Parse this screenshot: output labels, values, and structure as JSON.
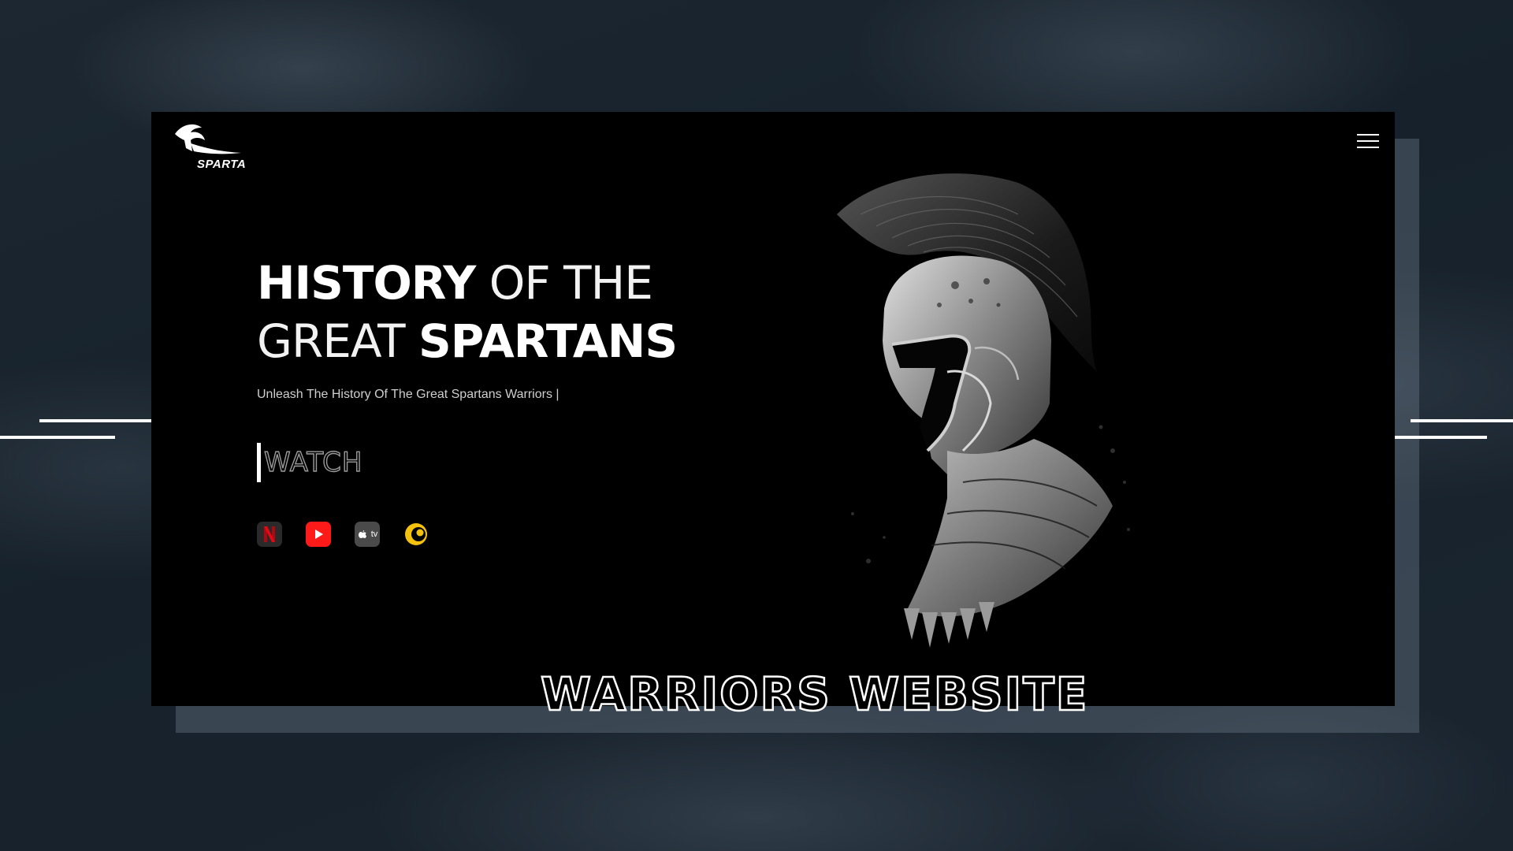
{
  "brand": {
    "logo_text": "SPARTA"
  },
  "hero": {
    "title_line1_bold": "HISTORY",
    "title_line1_thin": " OF THE",
    "title_line2_thin": "GREAT ",
    "title_line2_bold": "SPARTANS",
    "subtitle": "Unleash The History Of The Great Spartans Warriors |",
    "watch_label": "WATCH"
  },
  "platforms": [
    {
      "name": "Netflix",
      "icon": "netflix-icon",
      "color": "#e50914"
    },
    {
      "name": "YouTube",
      "icon": "youtube-icon",
      "color": "#ff1a1a"
    },
    {
      "name": "Apple TV",
      "icon": "appletv-icon",
      "color": "#4a4a4a"
    },
    {
      "name": "Crunchyroll",
      "icon": "crunchyroll-icon",
      "color": "#f4c20d"
    }
  ],
  "platform_labels": {
    "appletv": "tv"
  },
  "footer": {
    "title": "WARRIORS WEBSITE"
  },
  "colors": {
    "background": "#1b2631",
    "frame": "#000000",
    "accent": "#ffffff"
  }
}
